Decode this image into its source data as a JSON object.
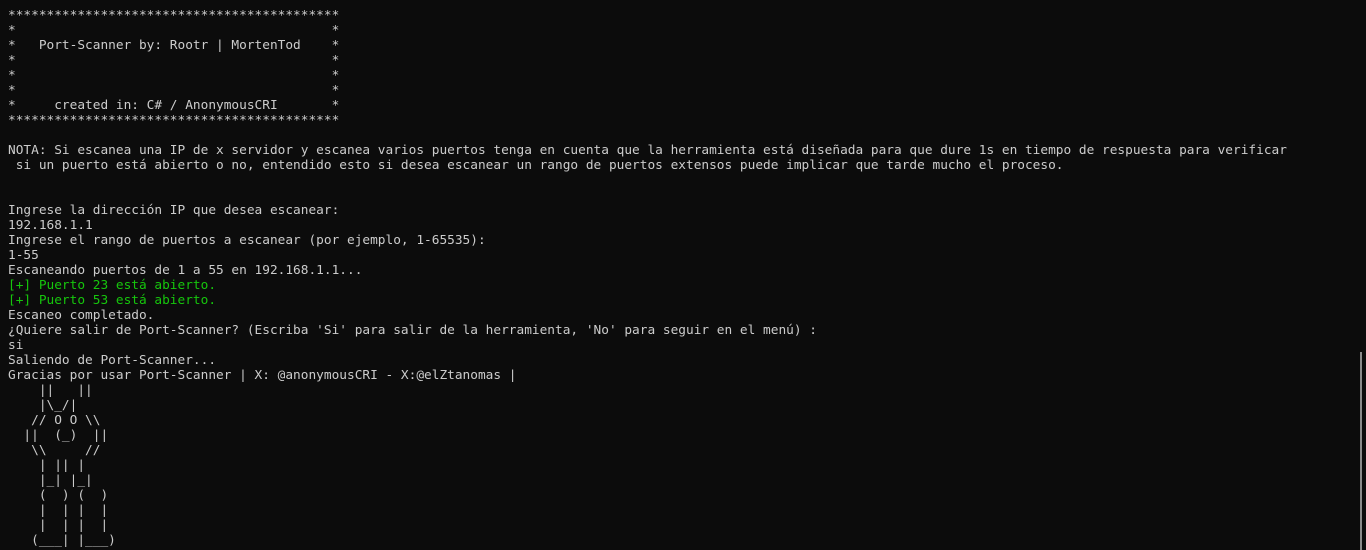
{
  "terminal": {
    "lines": [
      {
        "text": "*******************************************",
        "tone": "normal"
      },
      {
        "text": "*                                         *",
        "tone": "normal"
      },
      {
        "text": "*   Port-Scanner by: Rootr | MortenTod    *",
        "tone": "normal"
      },
      {
        "text": "*                                         *",
        "tone": "normal"
      },
      {
        "text": "*                                         *",
        "tone": "normal"
      },
      {
        "text": "*                                         *",
        "tone": "normal"
      },
      {
        "text": "*     created in: C# / AnonymousCRI       *",
        "tone": "normal"
      },
      {
        "text": "*******************************************",
        "tone": "normal"
      },
      {
        "text": "",
        "tone": "normal"
      },
      {
        "text": "NOTA: Si escanea una IP de x servidor y escanea varios puertos tenga en cuenta que la herramienta está diseñada para que dure 1s en tiempo de respuesta para verificar",
        "tone": "normal"
      },
      {
        "text": " si un puerto está abierto o no, entendido esto si desea escanear un rango de puertos extensos puede implicar que tarde mucho el proceso.",
        "tone": "normal"
      },
      {
        "text": "",
        "tone": "normal"
      },
      {
        "text": "",
        "tone": "normal"
      },
      {
        "text": "Ingrese la dirección IP que desea escanear:",
        "tone": "normal"
      },
      {
        "text": "192.168.1.1",
        "tone": "normal"
      },
      {
        "text": "Ingrese el rango de puertos a escanear (por ejemplo, 1-65535):",
        "tone": "normal"
      },
      {
        "text": "1-55",
        "tone": "normal"
      },
      {
        "text": "Escaneando puertos de 1 a 55 en 192.168.1.1...",
        "tone": "normal"
      },
      {
        "text": "[+] Puerto 23 está abierto.",
        "tone": "ok"
      },
      {
        "text": "[+] Puerto 53 está abierto.",
        "tone": "ok"
      },
      {
        "text": "Escaneo completado.",
        "tone": "normal"
      },
      {
        "text": "¿Quiere salir de Port-Scanner? (Escriba 'Si' para salir de la herramienta, 'No' para seguir en el menú) :",
        "tone": "normal"
      },
      {
        "text": "si",
        "tone": "normal"
      },
      {
        "text": "Saliendo de Port-Scanner...",
        "tone": "normal"
      },
      {
        "text": "Gracias por usar Port-Scanner | X: @anonymousCRI - X:@elZtanomas |",
        "tone": "normal"
      },
      {
        "text": "    ||   ||",
        "tone": "normal"
      },
      {
        "text": "    |\\_/|",
        "tone": "normal"
      },
      {
        "text": "   // O O \\\\",
        "tone": "normal"
      },
      {
        "text": "  ||  (_)  ||",
        "tone": "normal"
      },
      {
        "text": "   \\\\     //",
        "tone": "normal"
      },
      {
        "text": "    | || |",
        "tone": "normal"
      },
      {
        "text": "    |_| |_|",
        "tone": "normal"
      },
      {
        "text": "    (  ) (  )",
        "tone": "normal"
      },
      {
        "text": "    |  | |  |",
        "tone": "normal"
      },
      {
        "text": "    |  | |  |",
        "tone": "normal"
      },
      {
        "text": "   (___| |___)",
        "tone": "normal"
      }
    ]
  }
}
